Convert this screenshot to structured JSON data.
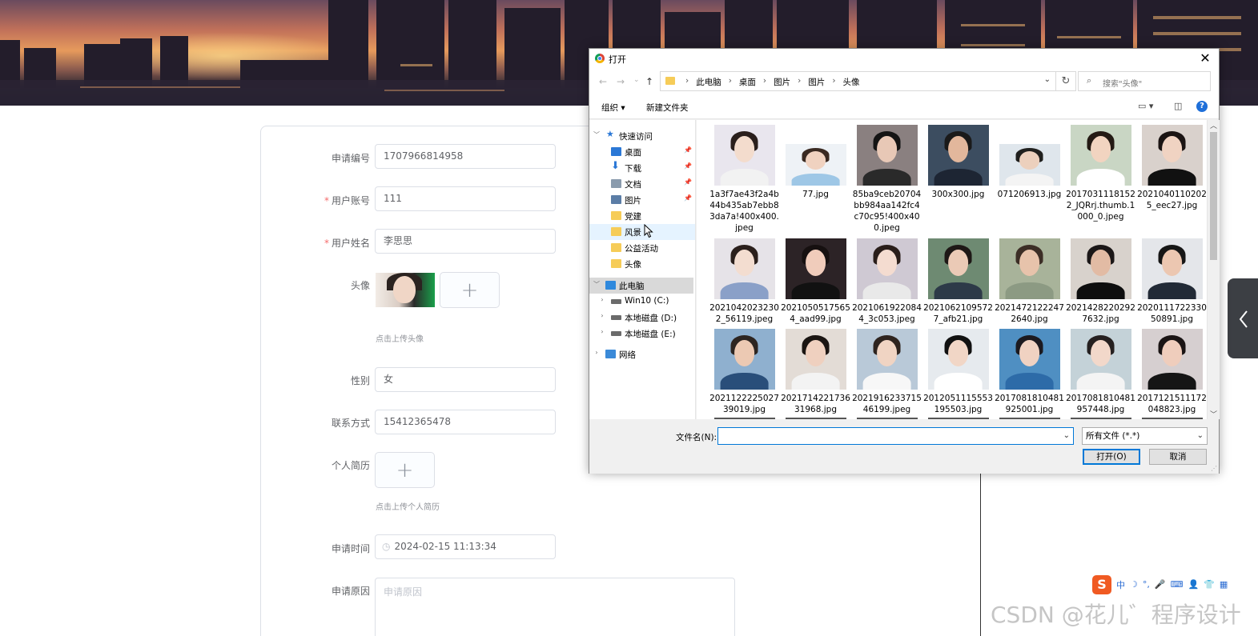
{
  "form": {
    "fields": [
      {
        "label": "申请编号",
        "required": false,
        "value": "1707966814958"
      },
      {
        "label": "用户账号",
        "required": true,
        "value": "111"
      },
      {
        "label": "用户姓名",
        "required": true,
        "value": "李思思"
      },
      {
        "label": "头像",
        "required": false,
        "tip": "点击上传头像"
      },
      {
        "label": "性别",
        "required": false,
        "value": "女"
      },
      {
        "label": "联系方式",
        "required": false,
        "value": "15412365478"
      },
      {
        "label": "个人简历",
        "required": false,
        "tip": "点击上传个人简历"
      },
      {
        "label": "申请时间",
        "required": false,
        "value": "2024-02-15 11:13:34"
      },
      {
        "label": "申请原因",
        "required": false,
        "placeholder": "申请原因"
      }
    ],
    "required_mark": "*",
    "upload_plus": "+"
  },
  "dialog": {
    "title": "打开",
    "close": "✕",
    "nav": {
      "back": "←",
      "forward": "→",
      "recent": "⌄",
      "up": "↑"
    },
    "breadcrumb": [
      "此电脑",
      "桌面",
      "图片",
      "图片",
      "头像"
    ],
    "breadcrumb_sep": "›",
    "refresh": "↻",
    "search_placeholder": "搜索\"头像\"",
    "toolbar": {
      "organize": "组织 ▾",
      "new_folder": "新建文件夹",
      "help": "?"
    },
    "nav_tree": [
      {
        "label": "快速访问",
        "kind": "header-quick"
      },
      {
        "label": "桌面",
        "icon": "desktop-icon",
        "pinned": true
      },
      {
        "label": "下载",
        "icon": "download-icon",
        "pinned": true
      },
      {
        "label": "文档",
        "icon": "document-icon",
        "pinned": true
      },
      {
        "label": "图片",
        "icon": "pictures-icon",
        "pinned": true
      },
      {
        "label": "党建",
        "icon": "folder-icon"
      },
      {
        "label": "风景",
        "icon": "folder-icon",
        "hovered": true
      },
      {
        "label": "公益活动",
        "icon": "folder-icon"
      },
      {
        "label": "头像",
        "icon": "folder-icon"
      },
      {
        "label": "此电脑",
        "kind": "header-pc"
      },
      {
        "label": "Win10 (C:)",
        "icon": "drive-icon"
      },
      {
        "label": "本地磁盘 (D:)",
        "icon": "drive-icon"
      },
      {
        "label": "本地磁盘 (E:)",
        "icon": "drive-icon"
      },
      {
        "label": "网络",
        "icon": "network-icon"
      }
    ],
    "files": [
      {
        "name": "1a3f7ae43f2a4b44b435ab7ebb83da7a!400x400.jpeg",
        "skin": "#f3dccd",
        "hair": "#2a1f1c",
        "bg": "#e9e6ee",
        "cloth": "#f2f2f2"
      },
      {
        "name": "77.jpg",
        "skin": "#f0d2c0",
        "hair": "#3a2a22",
        "bg": "#eef2f6",
        "cloth": "#9ec7e6",
        "short": true
      },
      {
        "name": "85ba9ceb20704bb984aa142fc4c70c95!400x400.jpeg",
        "skin": "#e8c8b6",
        "hair": "#141414",
        "bg": "#8a8080",
        "cloth": "#2a2a2a"
      },
      {
        "name": "300x300.jpg",
        "skin": "#e2b79c",
        "hair": "#1a1a1a",
        "bg": "#3c4d60",
        "cloth": "#1d2533"
      },
      {
        "name": "071206913.jpg",
        "skin": "#ecd0bd",
        "hair": "#20201e",
        "bg": "#dfe6ec",
        "cloth": "#f4f4f4",
        "short": true
      },
      {
        "name": "20170311181522_JQRrj.thumb.1000_0.jpeg",
        "skin": "#f2d4c0",
        "hair": "#241a14",
        "bg": "#c9d6c4",
        "cloth": "#ffffff"
      },
      {
        "name": "20210401102025_eec27.jpg",
        "skin": "#f0d3c2",
        "hair": "#1b1413",
        "bg": "#d9d1cc",
        "cloth": "#111111"
      },
      {
        "name": "20210420232302_56119.jpeg",
        "skin": "#f3ddd0",
        "hair": "#2b201c",
        "bg": "#e6e3e8",
        "cloth": "#8aa0c8"
      },
      {
        "name": "20210505175654_aad99.jpg",
        "skin": "#f0ccbb",
        "hair": "#161010",
        "bg": "#2c2326",
        "cloth": "#111111"
      },
      {
        "name": "20210619220844_3c053.jpeg",
        "skin": "#f4dcd0",
        "hair": "#2a1e1a",
        "bg": "#cfc9d3",
        "cloth": "#e9e9e9"
      },
      {
        "name": "20210621095727_afb21.jpg",
        "skin": "#ebcab6",
        "hair": "#1e1816",
        "bg": "#6e8a72",
        "cloth": "#2d3a48"
      },
      {
        "name": "20214721222472640.jpg",
        "skin": "#e7c3ab",
        "hair": "#3c2e26",
        "bg": "#a8b39a",
        "cloth": "#8c9a83"
      },
      {
        "name": "20214282202927632.jpg",
        "skin": "#e2bba4",
        "hair": "#1b1717",
        "bg": "#d8d2cc",
        "cloth": "#0e0e0e"
      },
      {
        "name": "2020111722330 50891.jpg",
        "skin": "#ecc7b1",
        "hair": "#161616",
        "bg": "#e4e6ea",
        "cloth": "#222a36"
      },
      {
        "name": "2021122225027 39019.jpg",
        "skin": "#ecc9b3",
        "hair": "#2d2521",
        "bg": "#8fb0cf",
        "cloth": "#294e7a"
      },
      {
        "name": "2021714221736 31968.jpg",
        "skin": "#efd0bf",
        "hair": "#1b1512",
        "bg": "#e3dcd6",
        "cloth": "#f3f3f3"
      },
      {
        "name": "2021916233715 46199.jpeg",
        "skin": "#f0d4c3",
        "hair": "#2e241f",
        "bg": "#b9c9d8",
        "cloth": "#f7f7f7"
      },
      {
        "name": "2012051115553 195503.jpg",
        "skin": "#f1d6c6",
        "hair": "#111111",
        "bg": "#e6eaee",
        "cloth": "#ffffff"
      },
      {
        "name": "2017081810481 925001.jpg",
        "skin": "#f0d2c2",
        "hair": "#1c1a20",
        "bg": "#4f8fc2",
        "cloth": "#2d6ba8"
      },
      {
        "name": "2017081810481 957448.jpg",
        "skin": "#f2d8ca",
        "hair": "#252020",
        "bg": "#c4d2d8",
        "cloth": "#f4f4f4"
      },
      {
        "name": "2017121511172 048823.jpg",
        "skin": "#efcdbc",
        "hair": "#1a1414",
        "bg": "#d6cfd0",
        "cloth": "#151515"
      }
    ],
    "filename_label": "文件名(N):",
    "filename_value": "",
    "filter_value": "所有文件 (*.*)",
    "open_button": "打开(O)",
    "cancel_button": "取消"
  },
  "ime": {
    "logo": "S",
    "items": [
      "中",
      "☽",
      "°,",
      "🎤",
      "⌨",
      "👤",
      "👕",
      "▦"
    ]
  },
  "watermark": "CSDN @花儿゛程序设计"
}
